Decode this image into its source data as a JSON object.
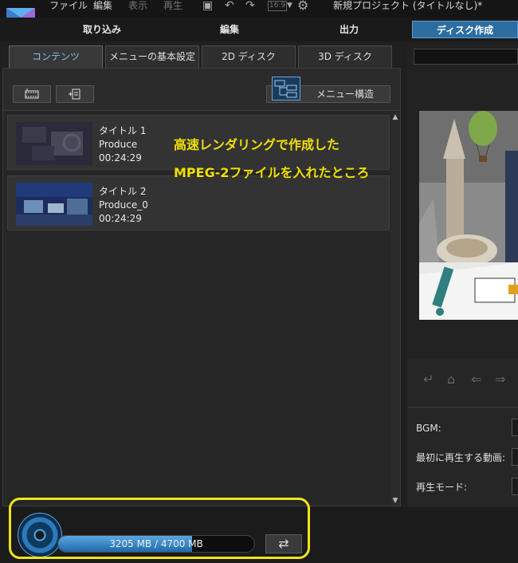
{
  "menubar": {
    "file": "ファイル",
    "edit": "編集",
    "view": "表示",
    "play": "再生",
    "aspect": "16:9",
    "project_title": "新規プロジェクト (タイトルなし)*"
  },
  "mode_tabs": {
    "capture": "取り込み",
    "edit": "編集",
    "produce": "出力",
    "disc": "ディスク作成"
  },
  "sub_tabs": {
    "content": "コンテンツ",
    "menu_settings": "メニューの基本設定",
    "disc2d": "2D ディスク",
    "disc3d": "3D ディスク"
  },
  "toolbar": {
    "menu_structure": "メニュー構造"
  },
  "titles": [
    {
      "name": "タイトル 1",
      "file": "Produce",
      "duration": "00:24:29"
    },
    {
      "name": "タイトル 2",
      "file": "Produce_0",
      "duration": "00:24:29"
    }
  ],
  "annotation": {
    "line1": "高速レンダリングで作成した",
    "line2": "MPEG-2ファイルを入れたところ"
  },
  "settings": {
    "bgm": "BGM:",
    "first_play": "最初に再生する動画:",
    "play_mode": "再生モード:"
  },
  "capacity": {
    "used_mb": 3205,
    "total_mb": 4700,
    "text": "3205 MB / 4700 MB"
  },
  "colors": {
    "accent": "#2d6da0",
    "annotation": "#f0e000",
    "highlight_border": "#f3e31c"
  }
}
